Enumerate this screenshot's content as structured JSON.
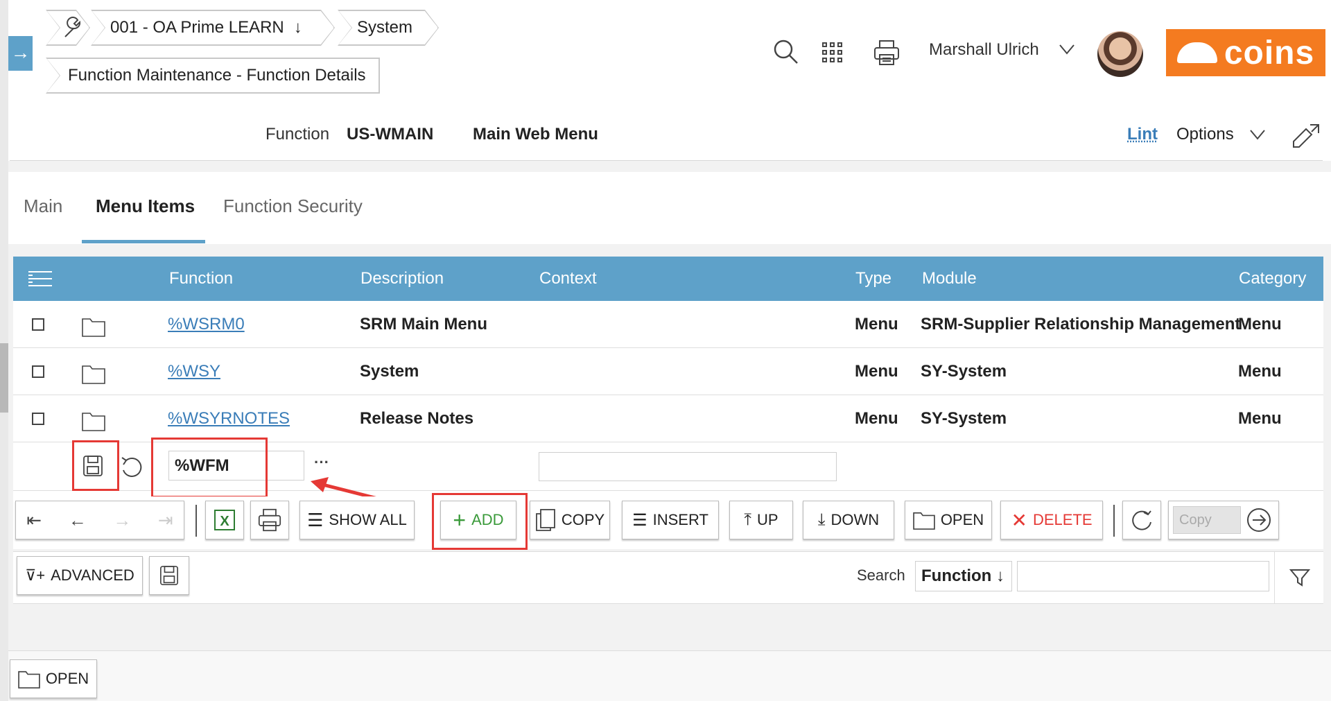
{
  "breadcrumb": {
    "company": "001 - OA Prime LEARN",
    "system": "System",
    "page": "Function Maintenance - Function Details"
  },
  "header": {
    "user_name": "Marshall Ulrich",
    "brand": "coins",
    "brand_color": "#f47b20"
  },
  "function_bar": {
    "label": "Function",
    "code": "US-WMAIN",
    "name": "Main Web Menu",
    "lint": "Lint",
    "options": "Options"
  },
  "tabs": [
    {
      "label": "Main"
    },
    {
      "label": "Menu Items",
      "active": true
    },
    {
      "label": "Function Security"
    }
  ],
  "grid": {
    "columns": [
      "Function",
      "Description",
      "Context",
      "Type",
      "Module",
      "Category"
    ],
    "rows": [
      {
        "function": "%WSRM0",
        "description": "SRM Main Menu",
        "context": "",
        "type": "Menu",
        "module": "SRM-Supplier Relationship Management",
        "category": "Menu"
      },
      {
        "function": "%WSY",
        "description": "System",
        "context": "",
        "type": "Menu",
        "module": "SY-System",
        "category": "Menu"
      },
      {
        "function": "%WSYRNOTES",
        "description": "Release Notes",
        "context": "",
        "type": "Menu",
        "module": "SY-System",
        "category": "Menu"
      }
    ],
    "new_row": {
      "function_value": "%WFM",
      "more": "···"
    }
  },
  "toolbar": {
    "show_all": "SHOW ALL",
    "add": "ADD",
    "copy": "COPY",
    "insert": "INSERT",
    "up": "UP",
    "down": "DOWN",
    "open": "OPEN",
    "delete": "DELETE",
    "copy_field": "Copy"
  },
  "filter_bar": {
    "advanced": "ADVANCED",
    "search_label": "Search",
    "search_field": "Function",
    "search_value": ""
  },
  "footer": {
    "open": "OPEN"
  },
  "colors": {
    "accent": "#5ea1c9",
    "highlight": "#e53935",
    "add": "#3a9a3a"
  }
}
